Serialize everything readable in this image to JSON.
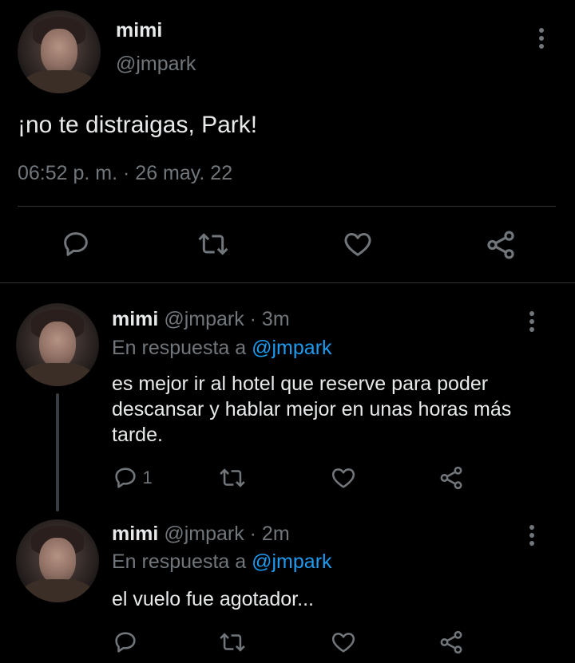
{
  "main_tweet": {
    "display_name": "mimi",
    "handle": "@jmpark",
    "text": "¡no te distraigas, Park!",
    "timestamp": "06:52 p. m. · 26 may. 22"
  },
  "replies": [
    {
      "display_name": "mimi",
      "handle_time": "@jmpark · 3m",
      "reply_prefix": "En respuesta a",
      "reply_to": "@jmpark",
      "text": "es mejor ir al hotel que reserve para poder descansar y hablar mejor en unas horas más tarde.",
      "reply_count": "1"
    },
    {
      "display_name": "mimi",
      "handle_time": "@jmpark · 2m",
      "reply_prefix": "En respuesta a",
      "reply_to": "@jmpark",
      "text": "el vuelo fue agotador...",
      "reply_count": ""
    }
  ],
  "icons": {
    "more": "more-vertical-icon",
    "reply": "reply-icon",
    "retweet": "retweet-icon",
    "like": "heart-icon",
    "share": "share-icon"
  },
  "colors": {
    "background": "#000000",
    "text": "#e7e9ea",
    "muted": "#71767b",
    "link": "#1d9bf0",
    "divider": "#2f3336"
  }
}
